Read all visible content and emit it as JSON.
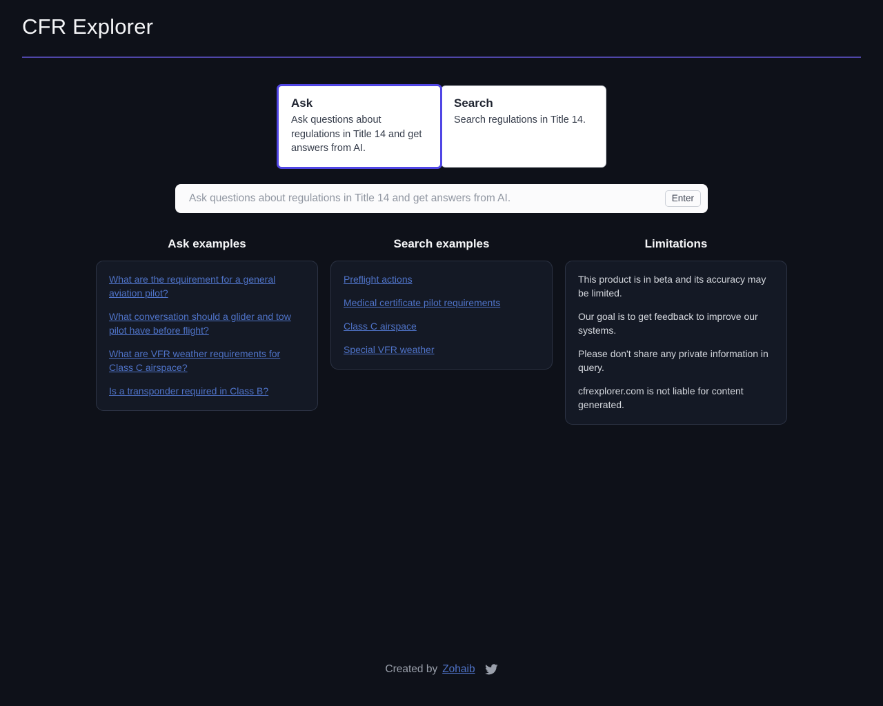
{
  "header": {
    "title": "CFR Explorer",
    "rule_color": "#4f46a8"
  },
  "tabs": [
    {
      "id": "ask",
      "title": "Ask",
      "description": "Ask questions about regulations in Title 14 and get answers from AI.",
      "selected": true,
      "border_color": "#5046e5"
    },
    {
      "id": "search",
      "title": "Search",
      "description": "Search regulations in Title 14.",
      "selected": false,
      "border_color": "#d2d5db"
    }
  ],
  "search": {
    "value": "",
    "placeholder": "Ask questions about regulations in Title 14 and get answers from AI.",
    "submit_label": "Enter"
  },
  "columns": [
    {
      "id": "ask-examples",
      "heading": "Ask examples",
      "type": "links",
      "items": [
        "What are the requirement for a general aviation pilot?",
        "What conversation should a glider and tow pilot have before flight?",
        "What are VFR weather requirements for Class C airspace?",
        "Is a transponder required in Class B?"
      ]
    },
    {
      "id": "search-examples",
      "heading": "Search examples",
      "type": "links",
      "items": [
        "Preflight actions",
        "Medical certificate pilot requirements",
        "Class C airspace",
        "Special VFR weather"
      ]
    },
    {
      "id": "limitations",
      "heading": "Limitations",
      "type": "notes",
      "items": [
        "This product is in beta and its accuracy may be limited.",
        "Our goal is to get feedback to improve our systems.",
        "Please don't share any private information in query.",
        "cfrexplorer.com is not liable for content generated."
      ]
    }
  ],
  "footer": {
    "text": "Created by",
    "link_label": "Zohaib",
    "icon": "twitter-icon"
  },
  "theme": {
    "background": "#0e1119",
    "card_background": "#141925",
    "card_border": "#2c3344",
    "link_color": "#4f73c8",
    "accent": "#5046e5",
    "muted_text": "#9aa0ab"
  }
}
